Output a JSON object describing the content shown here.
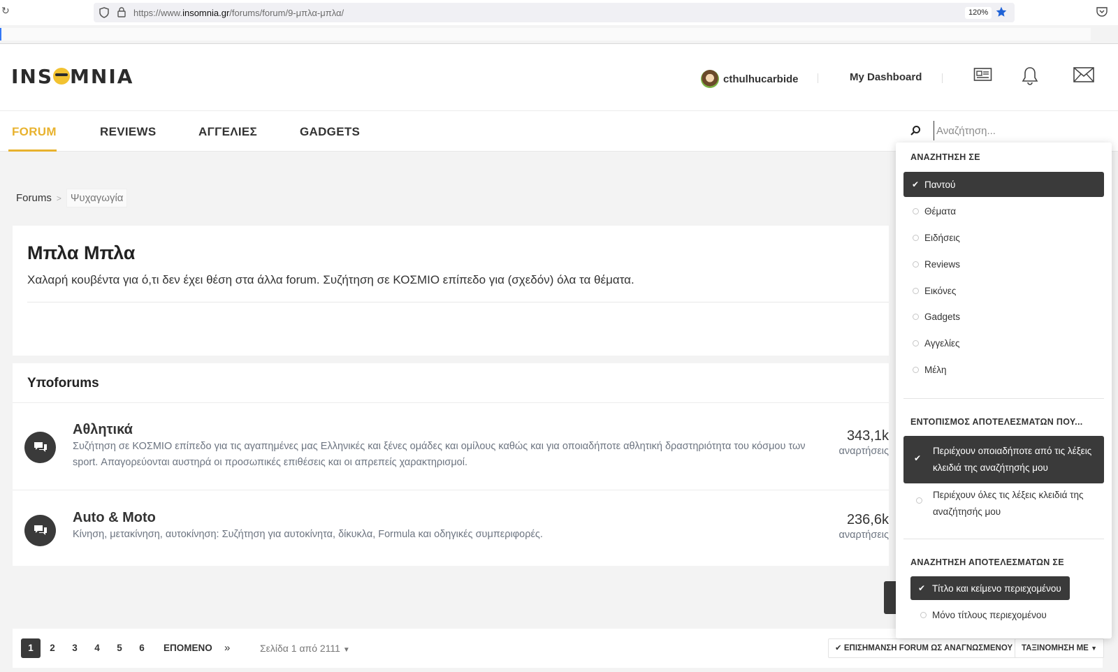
{
  "browser": {
    "url_prefix": "https://www.",
    "url_domain": "insomnia.gr",
    "url_path": "/forums/forum/9-μπλα-μπλα/",
    "zoom": "120%"
  },
  "header": {
    "logo_left": "INS",
    "logo_right": "MNIA",
    "username": "cthulhucarbide",
    "dashboard_label": "My Dashboard"
  },
  "nav": {
    "items": [
      "FORUM",
      "REVIEWS",
      "ΑΓΓΕΛΙΕΣ",
      "GADGETS"
    ],
    "active_index": 0
  },
  "search": {
    "placeholder": "Αναζήτηση...",
    "value": "",
    "menu": {
      "heading_scope": "ΑΝΑΖΗΤΗΣΗ ΣΕ",
      "scope_options": [
        "Παντού",
        "Θέματα",
        "Ειδήσεις",
        "Reviews",
        "Εικόνες",
        "Gadgets",
        "Αγγελίες",
        "Μέλη"
      ],
      "scope_selected": "Παντού",
      "heading_match": "ΕΝΤΟΠΙΣΜΟΣ ΑΠΟΤΕΛΕΣΜΑΤΩΝ ΠΟΥ...",
      "match_options": [
        "Περιέχουν οποιαδήποτε από τις λέξεις κλειδιά της αναζήτησής μου",
        "Περιέχουν όλες τις λέξεις κλειδιά της αναζήτησής μου"
      ],
      "match_selected": 0,
      "heading_in": "ΑΝΑΖΗΤΗΣΗ ΑΠΟΤΕΛΕΣΜΑΤΩΝ ΣΕ",
      "in_options": [
        "Τίτλο και κείμενο περιεχομένου",
        "Μόνο τίτλους περιεχομένου"
      ],
      "in_selected": 0
    }
  },
  "breadcrumb": {
    "root": "Forums",
    "current": "Ψυχαγωγία"
  },
  "forum": {
    "title": "Μπλα Μπλα",
    "description": "Χαλαρή κουβέντα για ό,τι δεν έχει θέση στα άλλα forum. Συζήτηση σε ΚΟΣΜΙΟ επίπεδο για (σχεδόν) όλα τα θέματα."
  },
  "subforums": {
    "heading": "Υποforums",
    "items": [
      {
        "name": "Αθλητικά",
        "description": "Συζήτηση σε ΚΟΣΜΙΟ επίπεδο για τις αγαπημένες μας Ελληνικές και ξένες ομάδες και ομίλους καθώς και για οποιαδήποτε αθλητική δραστηριότητα του κόσμου των sport. Απαγορεύονται αυστηρά οι προσωπικές επιθέσεις και οι απρεπείς χαρακτηρισμοί.",
        "posts": "343,1k",
        "posts_label": "αναρτήσεις"
      },
      {
        "name": "Auto & Moto",
        "description": "Κίνηση, μετακίνηση, αυτοκίνηση: Συζήτηση για αυτοκίνητα, δίκυκλα, Formula και οδηγικές συμπεριφορές.",
        "posts": "236,6k",
        "posts_label": "αναρτήσεις"
      }
    ]
  },
  "pagination": {
    "pages": [
      "1",
      "2",
      "3",
      "4",
      "5",
      "6"
    ],
    "current": "1",
    "next_label": "ΕΠΟΜΕΝΟ",
    "last_label": "»",
    "page_of": "Σελίδα 1 από 2111",
    "mark_read_label": "ΕΠΙΣΗΜΑΝΣΗ FORUM ΩΣ ΑΝΑΓΝΩΣΜΕΝΟΥ",
    "sort_label": "ΤΑΞΙΝΟΜΗΣΗ ΜΕ"
  },
  "colors": {
    "accent": "#e8b22e",
    "dark": "#3a3a3a",
    "muted_text": "#6c7480"
  }
}
